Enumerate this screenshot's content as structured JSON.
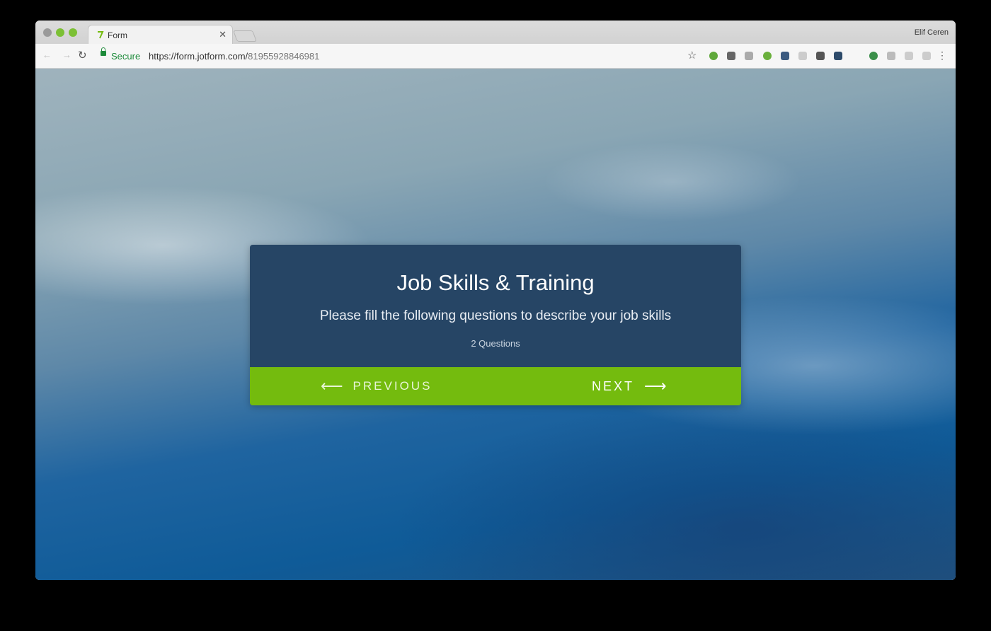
{
  "browser": {
    "tab_title": "Form",
    "profile_name": "Elif Ceren",
    "secure_label": "Secure",
    "url_host": "https://form.jotform.com/",
    "url_path": "81955928846981",
    "favicon_color": "#74bb0e"
  },
  "form": {
    "title": "Job Skills & Training",
    "description": "Please fill the following questions to describe your job skills",
    "question_count": "2 Questions",
    "previous_label": "PREVIOUS",
    "next_label": "NEXT",
    "card_color": "#264565",
    "nav_color": "#74bb0e"
  }
}
